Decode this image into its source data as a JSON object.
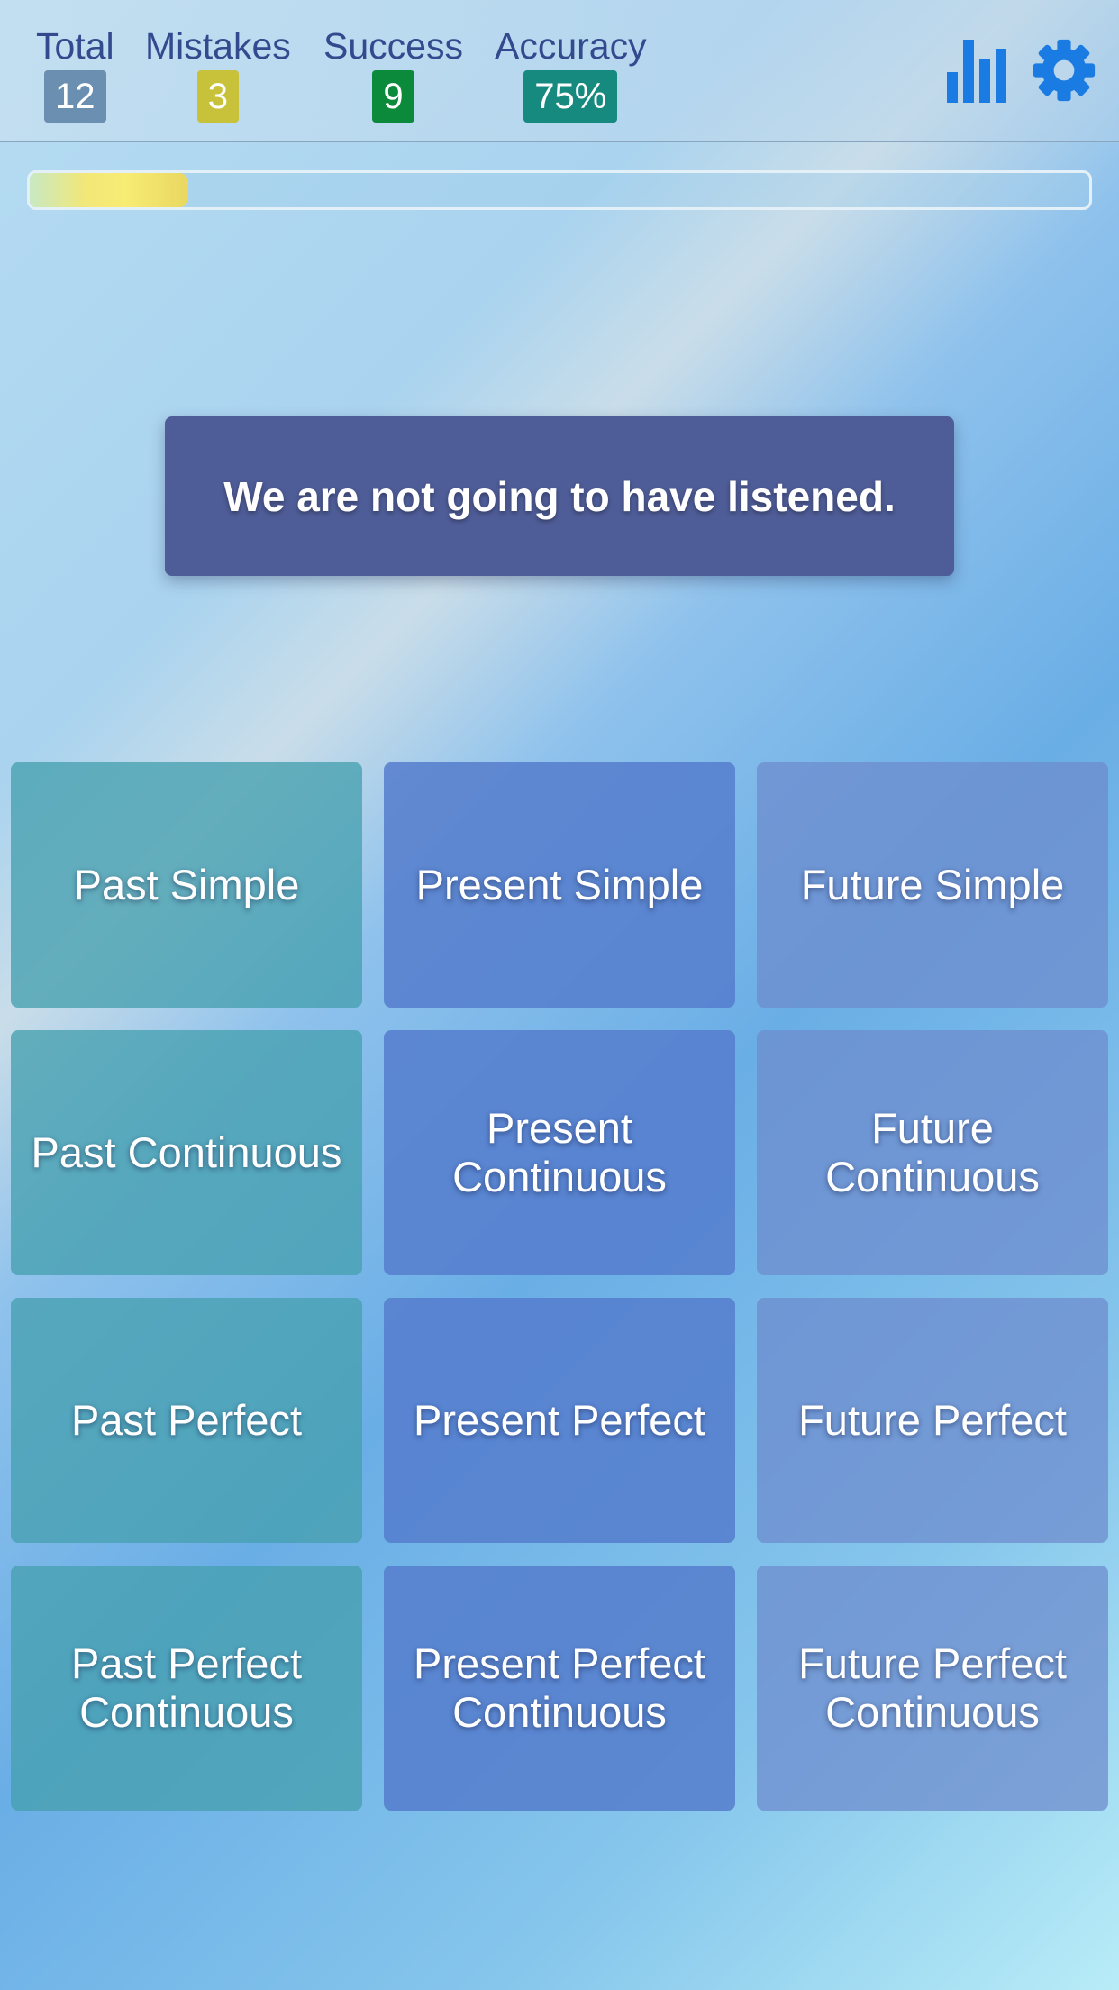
{
  "stats": [
    {
      "label": "Total",
      "value": "12",
      "color": "#6a8fb0"
    },
    {
      "label": "Mistakes",
      "value": "3",
      "color": "#c7c23a"
    },
    {
      "label": "Success",
      "value": "9",
      "color": "#0a8a3a"
    },
    {
      "label": "Accuracy",
      "value": "75%",
      "color": "#178a80"
    }
  ],
  "icons": {
    "stats": "bar-chart-icon",
    "settings": "gear-icon",
    "accent": "#1a7be3"
  },
  "progress": {
    "fraction": 0.15
  },
  "question": "We are not going to have listened.",
  "tiles": [
    {
      "label": "Past Simple"
    },
    {
      "label": "Present Simple"
    },
    {
      "label": "Future Simple"
    },
    {
      "label": "Past Continuous"
    },
    {
      "label": "Present Continuous"
    },
    {
      "label": "Future Continuous"
    },
    {
      "label": "Past Perfect"
    },
    {
      "label": "Present Perfect"
    },
    {
      "label": "Future Perfect"
    },
    {
      "label": "Past Perfect Continuous"
    },
    {
      "label": "Present Perfect Continuous"
    },
    {
      "label": "Future Perfect Continuous"
    }
  ]
}
